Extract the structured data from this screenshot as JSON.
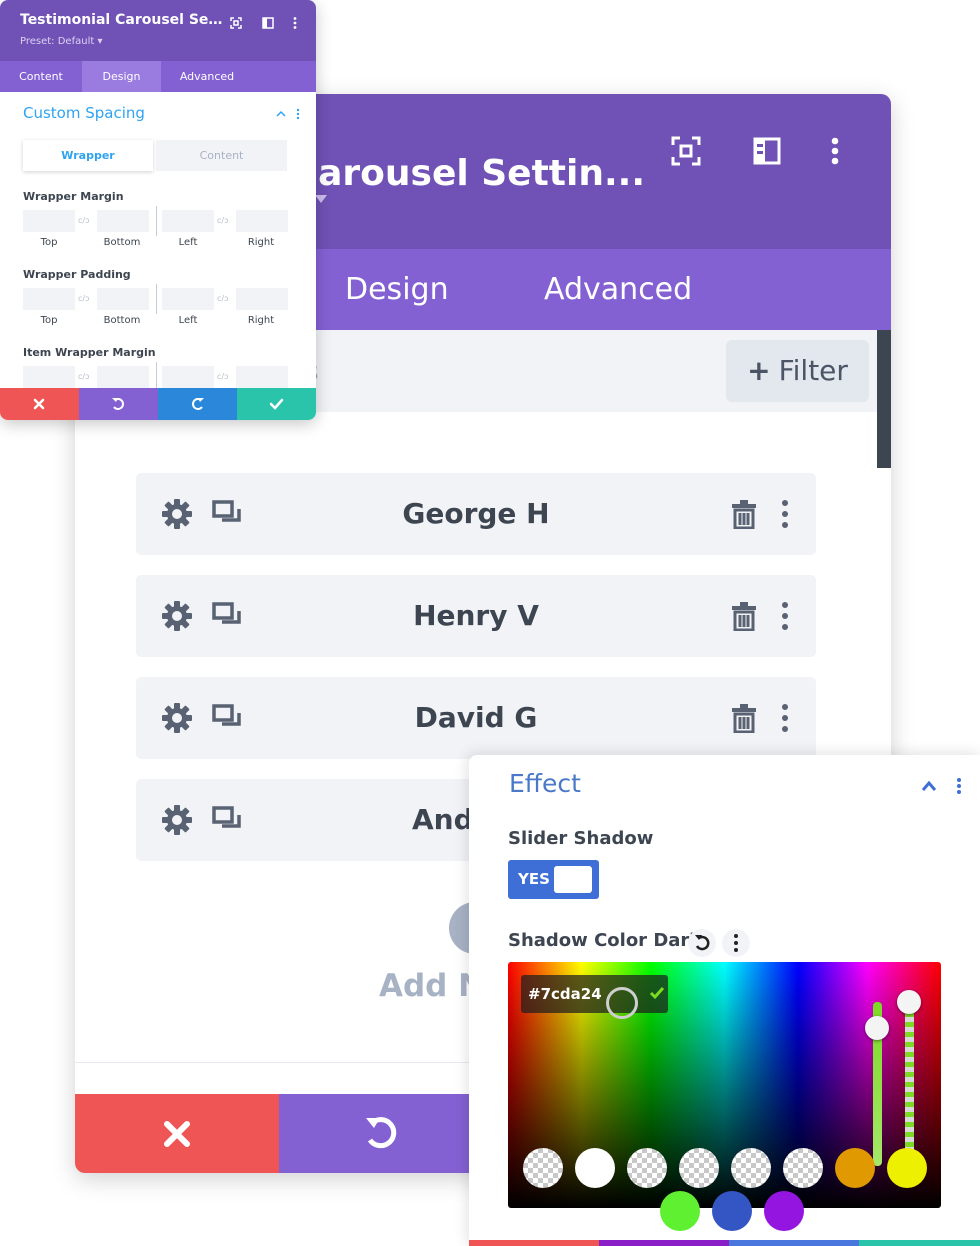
{
  "main_panel": {
    "title": "al Carousel Settin...",
    "tabs": [
      {
        "label": "Design"
      },
      {
        "label": "Advanced"
      }
    ],
    "filter_partial_text": "s",
    "filter_button": {
      "icon": "plus-icon",
      "label": "Filter"
    },
    "items": [
      {
        "name": "George H"
      },
      {
        "name": "Henry V"
      },
      {
        "name": "David G"
      },
      {
        "name": "Andr"
      }
    ],
    "add_new_partial": "Add Ne",
    "footer_buttons": [
      "close-icon",
      "undo-icon"
    ],
    "colors": {
      "header": "#7052b6",
      "tabs": "#8461d3",
      "discard": "#ef5555",
      "undo": "#8461d3"
    }
  },
  "settings_panel": {
    "title": "Testimonial Carousel Settin...",
    "preset": "Preset: Default ▾",
    "tabs": [
      {
        "label": "Content"
      },
      {
        "label": "Design",
        "active": true
      },
      {
        "label": "Advanced"
      }
    ],
    "section_title": "Custom Spacing",
    "subtabs": [
      {
        "label": "Wrapper",
        "active": true
      },
      {
        "label": "Content"
      }
    ],
    "groups": [
      {
        "label": "Wrapper Margin",
        "fields": [
          "Top",
          "Bottom",
          "Left",
          "Right"
        ]
      },
      {
        "label": "Wrapper Padding",
        "fields": [
          "Top",
          "Bottom",
          "Left",
          "Right"
        ]
      },
      {
        "label": "Item Wrapper Margin",
        "fields": []
      }
    ],
    "link_glyph": "c/ↄ",
    "footer_buttons": [
      "close-icon",
      "undo-icon",
      "redo-icon",
      "check-icon"
    ],
    "footer_colors": [
      "#ef5555",
      "#8461d3",
      "#2b87da",
      "#29c4a9"
    ]
  },
  "effect_panel": {
    "title": "Effect",
    "slider_shadow_label": "Slider Shadow",
    "toggle_label": "YES",
    "shadow_color_label": "Shadow Color Dark",
    "hex_value": "#7cda24",
    "swatches_row1": [
      "transparent",
      "#ffffff",
      "transparent",
      "transparent",
      "transparent",
      "transparent",
      "#e09900",
      "#edf000"
    ],
    "swatches_row2": [
      "#5ff031",
      "#3456c4",
      "#9414e0"
    ],
    "bottom_bar_colors": [
      "#ef5555",
      "#8a1fc7",
      "#4a77dd",
      "#29c4a9"
    ]
  }
}
